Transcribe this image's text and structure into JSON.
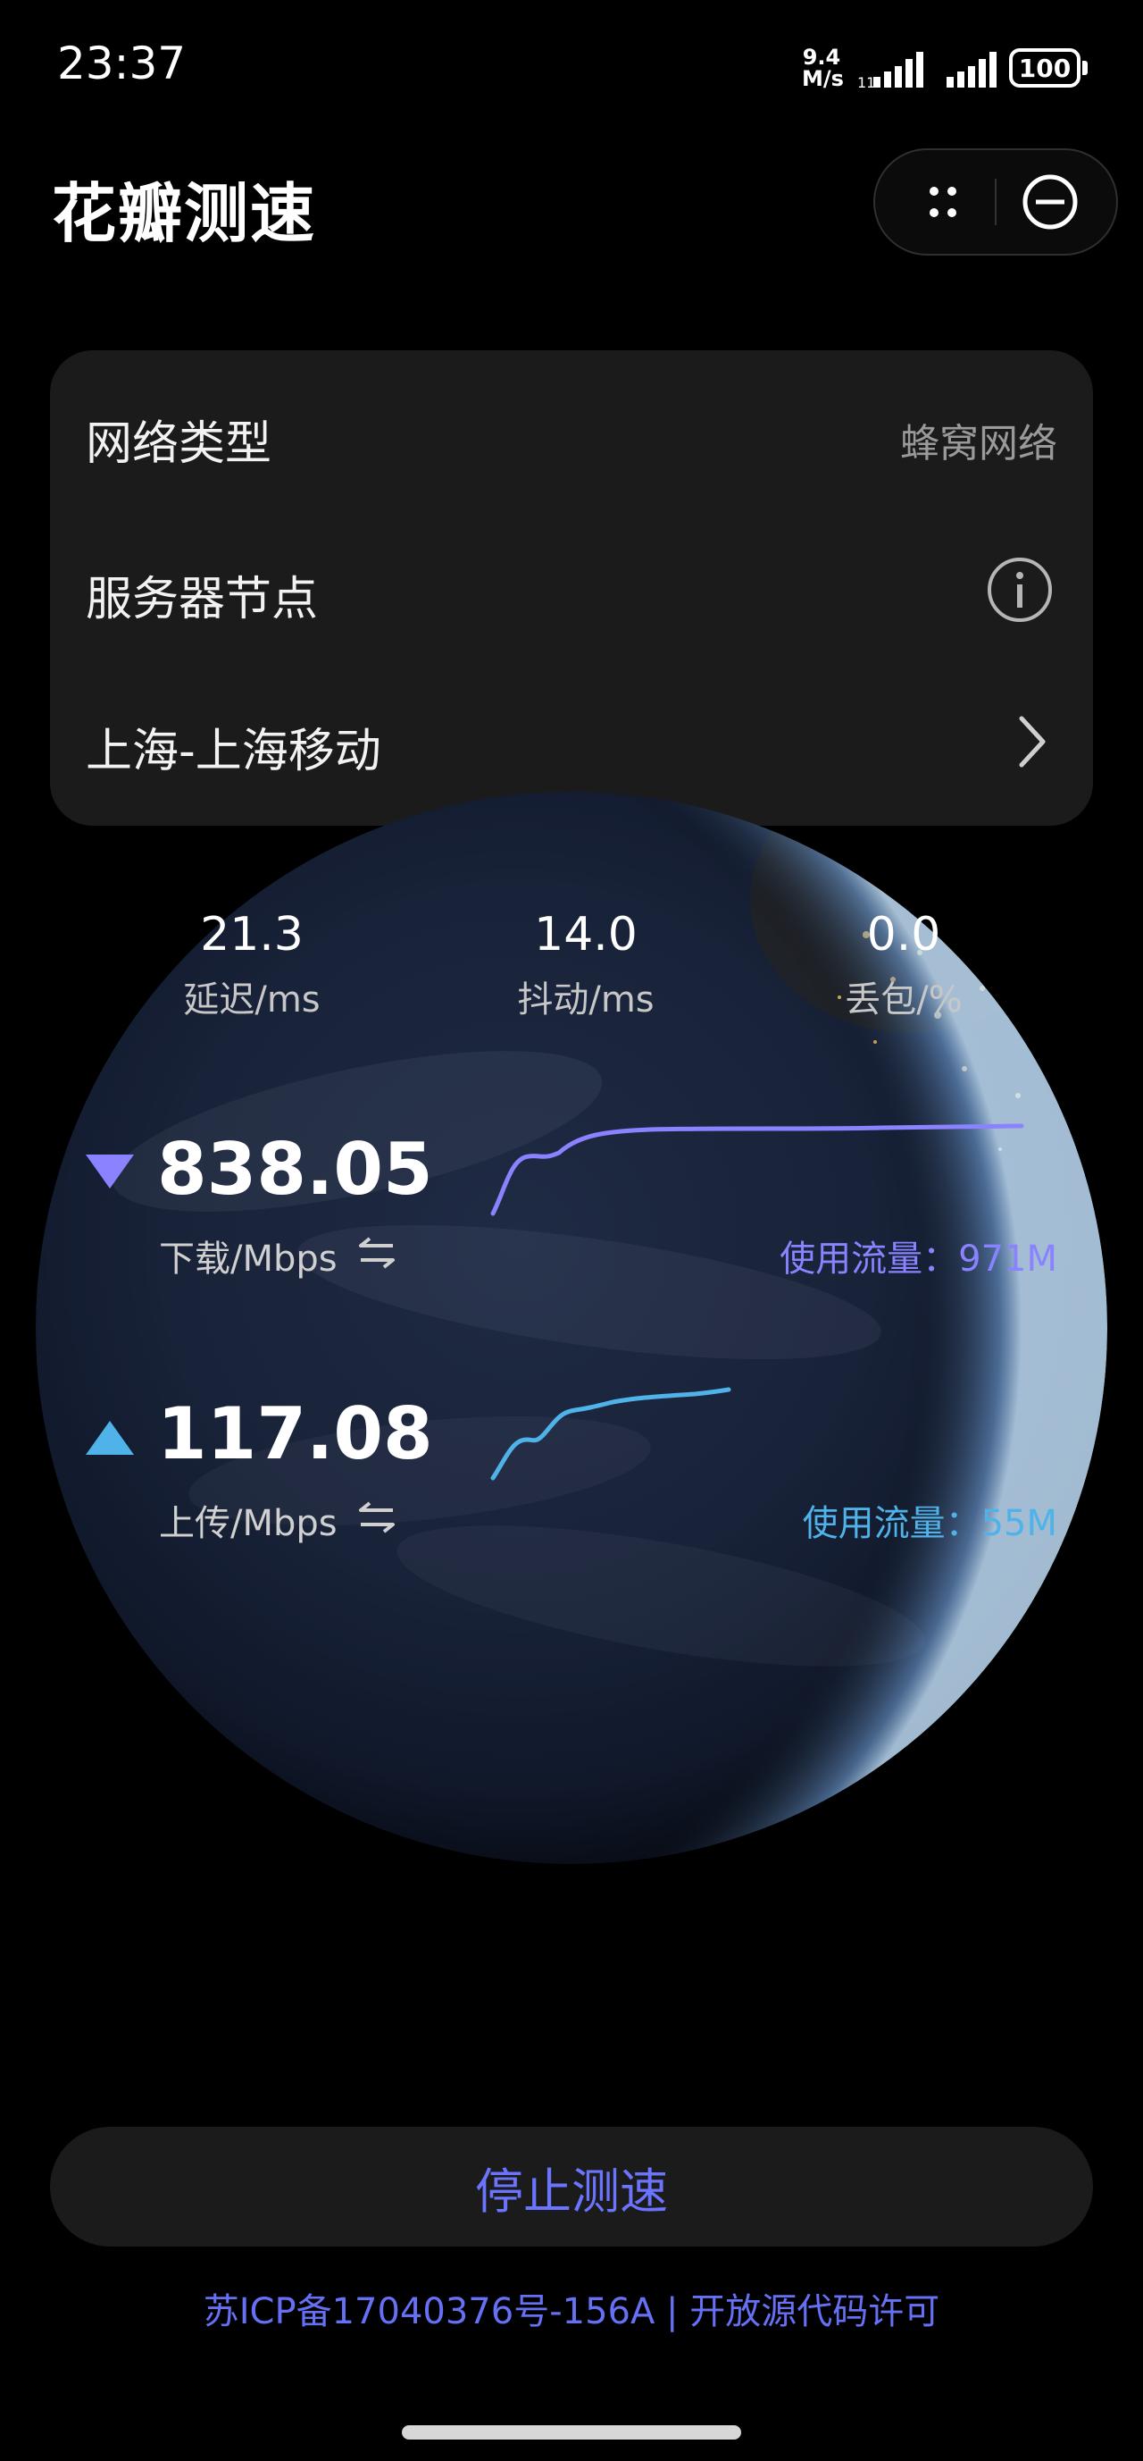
{
  "status_bar": {
    "time": "23:37",
    "net_speed_value": "9.4",
    "net_speed_unit": "M/s",
    "battery": "100"
  },
  "header": {
    "title": "花瓣测速",
    "more_icon": "four-dots-icon",
    "close_icon": "minus-circle-icon"
  },
  "info_card": {
    "network_type_label": "网络类型",
    "network_type_value": "蜂窝网络",
    "server_node_label": "服务器节点",
    "server_location": "上海-上海移动"
  },
  "metrics": {
    "latency": {
      "value": "21.3",
      "label": "延迟/ms"
    },
    "jitter": {
      "value": "14.0",
      "label": "抖动/ms"
    },
    "loss": {
      "value": "0.0",
      "label": "丢包/%"
    }
  },
  "download": {
    "value": "838.05",
    "label": "下载/Mbps",
    "usage": "使用流量：971M",
    "color": "#8a82ff"
  },
  "upload": {
    "value": "117.08",
    "label": "上传/Mbps",
    "usage": "使用流量：55M",
    "color": "#4fb2e8"
  },
  "stop_button": "停止测速",
  "footer": "苏ICP备17040376号-156A | 开放源代码许可"
}
